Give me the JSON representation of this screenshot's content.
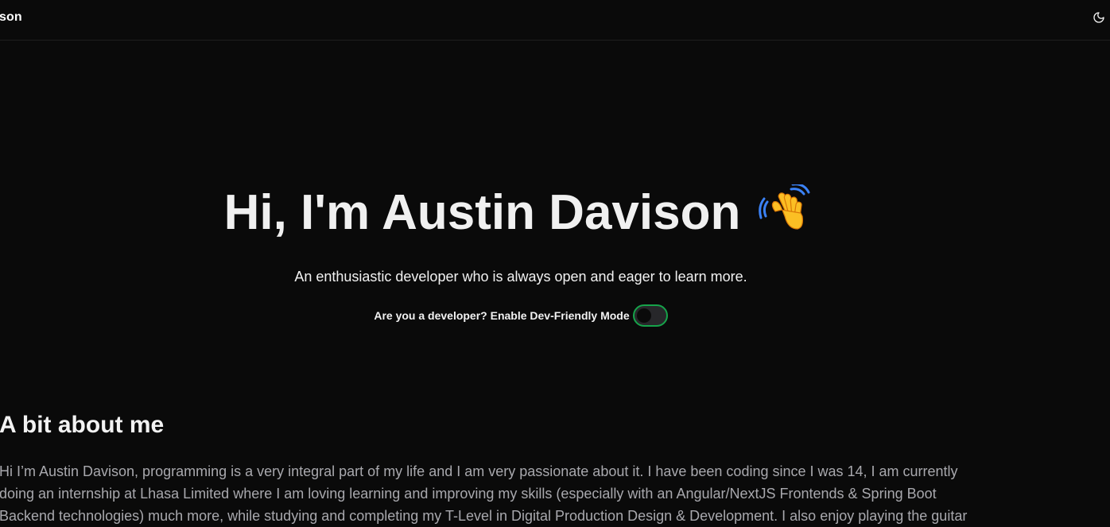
{
  "header": {
    "brand": "son",
    "theme_toggle_icon": "moon-icon"
  },
  "hero": {
    "title": "Hi, I'm Austin Davison",
    "wave_icon": "waving-hand-icon",
    "subtitle": "An enthusiastic developer who is always open and eager to learn more.",
    "dev_mode_label": "Are you a developer? Enable Dev-Friendly Mode",
    "dev_mode_enabled": false
  },
  "about": {
    "title": "A bit about me",
    "lines": [
      "Hi I’m Austin Davison, programming is a very integral part of my life and I am very passionate about it. I have been coding since I was 14, I am currently",
      "doing an internship at Lhasa Limited where I am loving learning and improving my skills (especially with an Angular/NextJS Frontends & Spring Boot",
      "Backend technologies) much more, while studying and completing my T-Level in Digital Production Design & Development. I also enjoy playing the guitar"
    ]
  },
  "colors": {
    "background": "#0a0a0a",
    "toggle_border": "#16a34a",
    "body_text": "#a8a8ad"
  }
}
